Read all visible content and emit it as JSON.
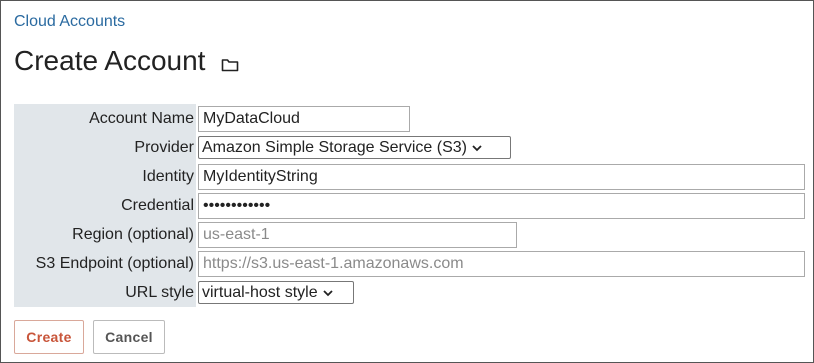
{
  "breadcrumb": {
    "label": "Cloud Accounts"
  },
  "page": {
    "title": "Create Account"
  },
  "form": {
    "account_name": {
      "label": "Account Name",
      "value": "MyDataCloud"
    },
    "provider": {
      "label": "Provider",
      "value": "Amazon Simple Storage Service (S3)"
    },
    "identity": {
      "label": "Identity",
      "value": "MyIdentityString"
    },
    "credential": {
      "label": "Credential",
      "value": "••••••••••••"
    },
    "region": {
      "label": "Region (optional)",
      "value": "",
      "placeholder": "us-east-1"
    },
    "s3_endpoint": {
      "label": "S3 Endpoint (optional)",
      "value": "",
      "placeholder": "https://s3.us-east-1.amazonaws.com"
    },
    "url_style": {
      "label": "URL style",
      "value": "virtual-host style"
    }
  },
  "buttons": {
    "create": "Create",
    "cancel": "Cancel"
  },
  "icons": {
    "title_icon": "folder-icon",
    "dropdown_icon": "chevron-down-icon"
  },
  "colors": {
    "link": "#2a6aa0",
    "label_bg": "#e1e6ea",
    "create_text": "#c8553a"
  }
}
